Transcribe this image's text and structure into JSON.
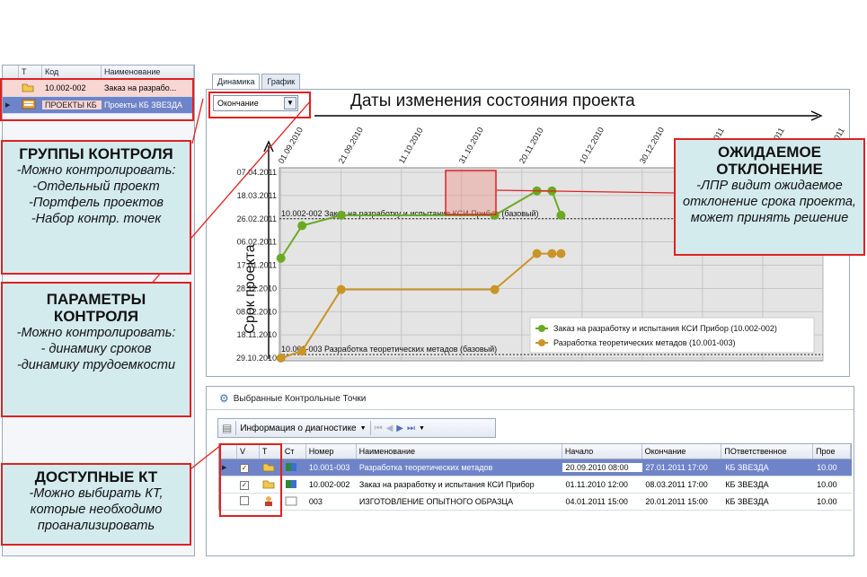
{
  "left_grid": {
    "headers": [
      "T",
      "Код",
      "Наименование"
    ],
    "rows": [
      {
        "code": "10.002-002",
        "name": "Заказ на разрабо..."
      },
      {
        "code": "ПРОЕКТЫ КБ",
        "name": "Проекты КБ ЗВЕЗДА"
      }
    ]
  },
  "tabs": [
    "Динамика",
    "График"
  ],
  "combo": {
    "value": "Окончание"
  },
  "chart_title": "Даты изменения состояния проекта",
  "chart_data": {
    "type": "line",
    "x_ticks": [
      "01.09.2010",
      "21.09.2010",
      "11.10.2010",
      "31.10.2010",
      "20.11.2010",
      "10.12.2010",
      "30.12.2010",
      "19.01.2011",
      "08.02.2011",
      "28.02.2011"
    ],
    "y_ticks": [
      "07.04.2011",
      "18.03.2011",
      "26.02.2011",
      "06.02.2011",
      "17.01.2011",
      "28.12.2010",
      "08.12.2010",
      "18.11.2010",
      "29.10.2010"
    ],
    "ylabel": "Срок проекта",
    "baselines": [
      {
        "label": "10.002-002 Заказ на разработку и испытания КСИ Прибор (базовый)",
        "y": "26.02.2011"
      },
      {
        "label": "10.001-003 Разработка теоретических метадов (базовый)",
        "y": "01.11.2010"
      }
    ],
    "series": [
      {
        "name": "Заказ на разработку и испытания КСИ Прибор (10.002-002)",
        "color": "#6aaa22",
        "x": [
          "01.09.2010",
          "08.09.2010",
          "21.09.2010",
          "11.11.2010",
          "25.11.2010",
          "30.11.2010",
          "03.12.2010"
        ],
        "y": [
          "23.01.2011",
          "20.02.2011",
          "01.03.2011",
          "01.03.2011",
          "22.03.2011",
          "22.03.2011",
          "01.03.2011"
        ]
      },
      {
        "name": "Разработка теоретических метадов (10.001-003)",
        "color": "#c99526",
        "x": [
          "01.09.2010",
          "08.09.2010",
          "21.09.2010",
          "11.11.2010",
          "25.11.2010",
          "30.11.2010",
          "03.12.2010"
        ],
        "y": [
          "29.10.2010",
          "04.11.2010",
          "27.12.2010",
          "27.12.2010",
          "27.01.2011",
          "27.01.2011",
          "27.01.2011"
        ]
      }
    ]
  },
  "callouts": {
    "groups": {
      "title": "ГРУППЫ КОНТРОЛЯ",
      "lines": [
        "-Можно контролировать:",
        "-Отдельный проект",
        "-Портфель проектов",
        "-Набор контр. точек"
      ]
    },
    "params": {
      "title": "ПАРАМЕТРЫ КОНТРОЛЯ",
      "lines": [
        "-Можно контролировать:",
        "- динамику сроков",
        "-динамику трудоемкости"
      ]
    },
    "kt": {
      "title": "ДОСТУПНЫЕ КТ",
      "lines": [
        "-Можно выбирать КТ, которые необходимо проанализировать"
      ]
    },
    "expected": {
      "title": "ОЖИДАЕМОЕ ОТКЛОНЕНИЕ",
      "lines": [
        "-ЛПР видит ожидаемое отклонение срока проекта, может принять решение"
      ]
    }
  },
  "bottom": {
    "title": "Выбранные Контрольные Точки",
    "toolbar_label": "Информация о диагностике",
    "headers": [
      "V",
      "T",
      "Ст",
      "Номер",
      "Наименование",
      "Начало",
      "Окончание",
      "ПОтветственное",
      "Прое"
    ],
    "rows": [
      {
        "num": "10.001-003",
        "name": "Разработка теоретических метадов",
        "start": "20.09.2010 08:00",
        "end": "27.01.2011 17:00",
        "resp": "КБ ЗВЕЗДА",
        "proj": "10.00"
      },
      {
        "num": "10.002-002",
        "name": "Заказ на разработку и испытания КСИ Прибор",
        "start": "01.11.2010 12:00",
        "end": "08.03.2011 17:00",
        "resp": "КБ ЗВЕЗДА",
        "proj": "10.00"
      },
      {
        "num": "003",
        "name": "ИЗГОТОВЛЕНИЕ ОПЫТНОГО ОБРАЗЦА",
        "start": "04.01.2011 15:00",
        "end": "20.01.2011 15:00",
        "resp": "КБ ЗВЕЗДА",
        "proj": "10.00"
      }
    ]
  }
}
